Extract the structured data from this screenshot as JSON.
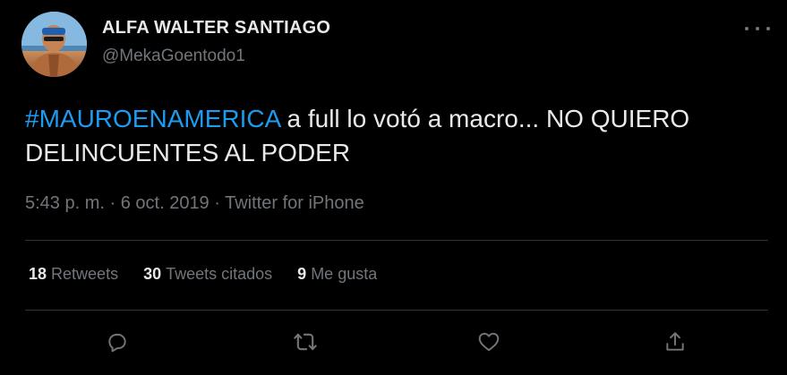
{
  "author": {
    "name": "ALFA WALTER SANTIAGO",
    "handle": "@MekaGoentodo1"
  },
  "tweet": {
    "hashtag": "#MAUROENAMERICA",
    "text": " a full lo votó a macro... NO QUIERO DELINCUENTES AL PODER"
  },
  "meta": {
    "time": "5:43 p. m.",
    "separator1": " · ",
    "date": "6 oct. 2019",
    "separator2": " · ",
    "source": "Twitter for iPhone"
  },
  "stats": {
    "retweets_count": "18",
    "retweets_label": "Retweets",
    "quotes_count": "30",
    "quotes_label": "Tweets citados",
    "likes_count": "9",
    "likes_label": "Me gusta"
  },
  "actions": {
    "reply": "reply-icon",
    "retweet": "retweet-icon",
    "like": "heart-icon",
    "share": "share-icon"
  },
  "colors": {
    "background": "#000000",
    "text": "#e7e9ea",
    "secondary": "#71767b",
    "link": "#1d9bf0",
    "divider": "#2f3336"
  }
}
